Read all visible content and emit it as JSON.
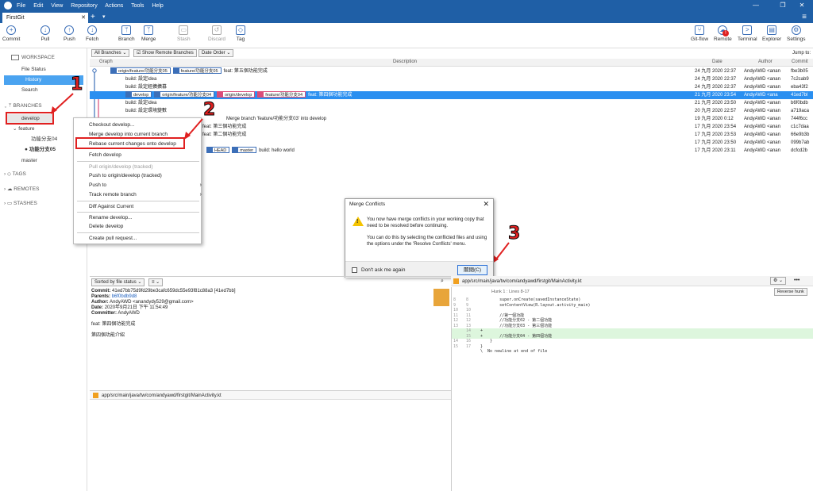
{
  "titlebar": {
    "menu": [
      "File",
      "Edit",
      "View",
      "Repository",
      "Actions",
      "Tools",
      "Help"
    ],
    "minimize": "—",
    "maximize": "❐",
    "close": "✕"
  },
  "tab": {
    "title": "FirstGit",
    "close": "✕",
    "add": "+",
    "dropdown": "▾",
    "hamburger": "≡"
  },
  "toolbar": {
    "commit": "Commit",
    "pull": "Pull",
    "push": "Push",
    "fetch": "Fetch",
    "branch": "Branch",
    "merge": "Merge",
    "stash": "Stash",
    "discard": "Discard",
    "tag": "Tag",
    "gitflow": "Git-flow",
    "remote": "Remote",
    "terminal": "Terminal",
    "explorer": "Explorer",
    "settings": "Settings",
    "remote_badge": "!"
  },
  "sidebar": {
    "workspace": "WORKSPACE",
    "file_status": "File Status",
    "history": "History",
    "search": "Search",
    "branches": "BRANCHES",
    "develop": "develop",
    "feature": "feature",
    "feat04": "功能分支04",
    "feat05": "功能分支05",
    "master": "master",
    "tags": "TAGS",
    "remotes": "REMOTES",
    "stashes": "STASHES"
  },
  "filters": {
    "branches": "All Branches ⌄",
    "show_remote": "Show Remote Branches",
    "order": "Date Order ⌄",
    "jump": "Jump to:"
  },
  "columns": {
    "graph": "Graph",
    "description": "Description",
    "date": "Date",
    "author": "Author",
    "commit": "Commit"
  },
  "commits": [
    {
      "refs": [
        "origin/feature/功能分支05",
        "feature/功能分支05"
      ],
      "msg": "feat: 第五個功能完成",
      "date": "24 九月 2020 22:37",
      "author": "AndyAWD <anan",
      "hash": "fbe3b05"
    },
    {
      "refs": [],
      "msg": "build: 設定idea",
      "date": "24 九月 2020 22:37",
      "author": "AndyAWD <anan",
      "hash": "7c2cab9"
    },
    {
      "refs": [],
      "msg": "build: 設定經擴擴募",
      "date": "24 九月 2020 22:37",
      "author": "AndyAWD <anan",
      "hash": "eba43f2"
    },
    {
      "refs": [
        "develop",
        "origin/feature/功能分支04",
        "origin/develop",
        "feature/功能分支04"
      ],
      "msg": "feat: 第四個功能完成",
      "date": "21 九月 2020 23:54",
      "author": "AndyAWD <ana",
      "hash": "41ed7bl"
    },
    {
      "refs": [],
      "msg": "build: 設定idea",
      "date": "21 九月 2020 23:50",
      "author": "AndyAWD <anan",
      "hash": "b6f0bdb"
    },
    {
      "refs": [],
      "msg": "build: 設定環境變數",
      "date": "20 九月 2020 22:57",
      "author": "AndyAWD <anan",
      "hash": "a719aca"
    },
    {
      "refs": [],
      "msg": "Merge branch 'feature/功能分支03' into develop",
      "date": "19 九月 2020 0:12",
      "author": "AndyAWD <anan",
      "hash": "744f6cc"
    },
    {
      "refs": [],
      "msg": "feat: 第三個功能完成",
      "date": "17 九月 2020 23:54",
      "author": "AndyAWD <anan",
      "hash": "c1c7daa"
    },
    {
      "refs": [],
      "msg": "feat: 第二個功能完成",
      "date": "17 九月 2020 23:53",
      "author": "AndyAWD <anan",
      "hash": "66e9b3b"
    },
    {
      "refs": [],
      "msg": "",
      "date": "17 九月 2020 23:50",
      "author": "AndyAWD <anan",
      "hash": "099b7ab"
    },
    {
      "refs": [
        "HEAD",
        "master"
      ],
      "msg": "build: hello world",
      "date": "17 九月 2020 23:11",
      "author": "AndyAWD <anan",
      "hash": "dcfcd2b"
    }
  ],
  "context_menu": {
    "checkout": "Checkout develop...",
    "merge": "Merge develop into current branch",
    "rebase": "Rebase current changes onto develop",
    "fetch": "Fetch develop",
    "pull": "Pull origin/develop (tracked)",
    "push_origin": "Push to origin/develop (tracked)",
    "push_to": "Push to",
    "track": "Track remote branch",
    "diff": "Diff Against Current",
    "rename": "Rename develop...",
    "delete": "Delete develop",
    "pull_request": "Create pull request...",
    "submenu_arrow": "›"
  },
  "annotations": {
    "n1": "1",
    "n2": "2",
    "n3": "3"
  },
  "dialog": {
    "title": "Merge Conflicts",
    "close": "✕",
    "line1": "You now have merge conflicts in your working copy that need to be resolved before continuing.",
    "line2": "You can do this by selecting the conflicted files and using the options under the 'Resolve Conflicts' menu.",
    "dont_ask": "Don't ask me again",
    "ok": "關閉(C)"
  },
  "bottom": {
    "sort": "Sorted by file status ⌄",
    "view": "≡ ⌄",
    "commit_label": "Commit:",
    "commit_val": "41ed7bb75d9fd29be3cafc659dc55e93f81c88a3 [41ed7bb]",
    "parents_label": "Parents:",
    "parents_val": "b6f0bdb9d8",
    "author_label": "Author:",
    "author_val": "AndyAWD <anandydy529@gmail.com>",
    "date_label": "Date:",
    "date_val": "2020年9月21日 下午 11:54:49",
    "committer_label": "Committer:",
    "committer_val": "AndyAWD",
    "subject": "feat: 第四個功能完成",
    "body": "第四個功能介紹",
    "file": "app/src/main/java/tw/com/andyawd/firstgit/MainActivity.kt",
    "hunk": "Hunk 1 : Lines 8-17",
    "reverse": "Reverse hunk",
    "more": "•••",
    "gear": "⚙ ⌄"
  },
  "diff": [
    {
      "n1": "8",
      "n2": "8",
      "code": "        super.onCreate(savedInstanceState)",
      "type": "ctx"
    },
    {
      "n1": "9",
      "n2": "9",
      "code": "        setContentView(R.layout.activity_main)",
      "type": "ctx"
    },
    {
      "n1": "10",
      "n2": "10",
      "code": "",
      "type": "ctx"
    },
    {
      "n1": "11",
      "n2": "11",
      "code": "        //第一個功能",
      "type": "ctx"
    },
    {
      "n1": "12",
      "n2": "12",
      "code": "        //功能分支02 - 第二個功能",
      "type": "ctx"
    },
    {
      "n1": "13",
      "n2": "13",
      "code": "        //功能分支03 - 第三個功能",
      "type": "ctx"
    },
    {
      "n1": "",
      "n2": "14",
      "code": "+",
      "type": "add"
    },
    {
      "n1": "",
      "n2": "15",
      "code": "+       //功能分支04 - 第四個功能",
      "type": "add"
    },
    {
      "n1": "14",
      "n2": "16",
      "code": "    }",
      "type": "ctx"
    },
    {
      "n1": "15",
      "n2": "17",
      "code": "}",
      "type": "ctx"
    },
    {
      "n1": "",
      "n2": "",
      "code": "\\  No newline at end of file",
      "type": "ctx"
    }
  ]
}
